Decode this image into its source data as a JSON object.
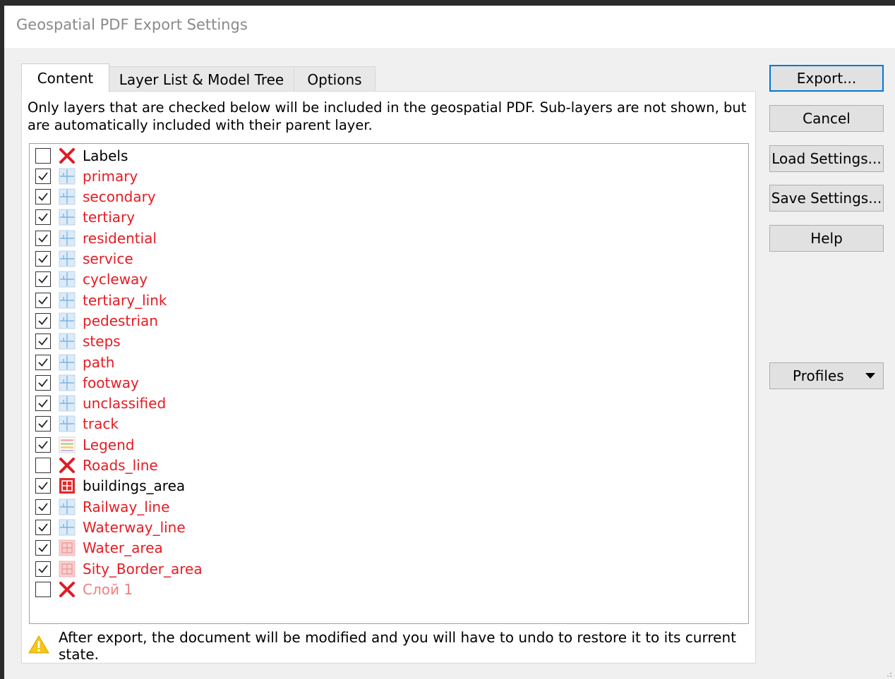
{
  "window": {
    "title": "Geospatial PDF Export Settings"
  },
  "tabs": [
    {
      "label": "Content",
      "active": true
    },
    {
      "label": "Layer List & Model Tree",
      "active": false
    },
    {
      "label": "Options",
      "active": false
    }
  ],
  "content": {
    "description": "Only layers that are checked below will be included in the geospatial PDF. Sub-layers are not shown, but are automatically included with their parent layer.",
    "layers": [
      {
        "name": "Labels",
        "checked": false,
        "icon": "x-icon",
        "color": "black"
      },
      {
        "name": "primary",
        "checked": true,
        "icon": "line-layer-icon",
        "color": "red"
      },
      {
        "name": "secondary",
        "checked": true,
        "icon": "line-layer-icon",
        "color": "red"
      },
      {
        "name": "tertiary",
        "checked": true,
        "icon": "line-layer-icon",
        "color": "red"
      },
      {
        "name": "residential",
        "checked": true,
        "icon": "line-layer-icon",
        "color": "red"
      },
      {
        "name": "service",
        "checked": true,
        "icon": "line-layer-icon",
        "color": "red"
      },
      {
        "name": "cycleway",
        "checked": true,
        "icon": "line-layer-icon",
        "color": "red"
      },
      {
        "name": "tertiary_link",
        "checked": true,
        "icon": "line-layer-icon",
        "color": "red"
      },
      {
        "name": "pedestrian",
        "checked": true,
        "icon": "line-layer-icon",
        "color": "red"
      },
      {
        "name": "steps",
        "checked": true,
        "icon": "line-layer-icon",
        "color": "red"
      },
      {
        "name": "path",
        "checked": true,
        "icon": "line-layer-icon",
        "color": "red"
      },
      {
        "name": "footway",
        "checked": true,
        "icon": "line-layer-icon",
        "color": "red"
      },
      {
        "name": "unclassified",
        "checked": true,
        "icon": "line-layer-icon",
        "color": "red"
      },
      {
        "name": "track",
        "checked": true,
        "icon": "line-layer-icon",
        "color": "red"
      },
      {
        "name": "Legend",
        "checked": true,
        "icon": "legend-icon",
        "color": "red"
      },
      {
        "name": "Roads_line",
        "checked": false,
        "icon": "x-icon",
        "color": "red"
      },
      {
        "name": "buildings_area",
        "checked": true,
        "icon": "area-layer-icon",
        "color": "black"
      },
      {
        "name": "Railway_line",
        "checked": true,
        "icon": "line-layer-icon",
        "color": "red"
      },
      {
        "name": "Waterway_line",
        "checked": true,
        "icon": "line-layer-icon",
        "color": "red"
      },
      {
        "name": "Water_area",
        "checked": true,
        "icon": "area-layer-faded-icon",
        "color": "red"
      },
      {
        "name": "Sity_Border_area",
        "checked": true,
        "icon": "area-layer-faded-icon",
        "color": "red"
      },
      {
        "name": "Слой 1",
        "checked": false,
        "icon": "x-icon",
        "color": "faded"
      }
    ],
    "warning": "After export, the document will be modified and you will have to undo to restore it to its current state."
  },
  "buttons": {
    "export": "Export...",
    "cancel": "Cancel",
    "load_settings": "Load Settings...",
    "save_settings": "Save Settings...",
    "help": "Help",
    "profiles": "Profiles"
  },
  "colors": {
    "layer_name_red": "#e41c24",
    "layer_name_faded": "#f08080",
    "default_button_border": "#0078d7",
    "warning_yellow": "#f5c518"
  }
}
